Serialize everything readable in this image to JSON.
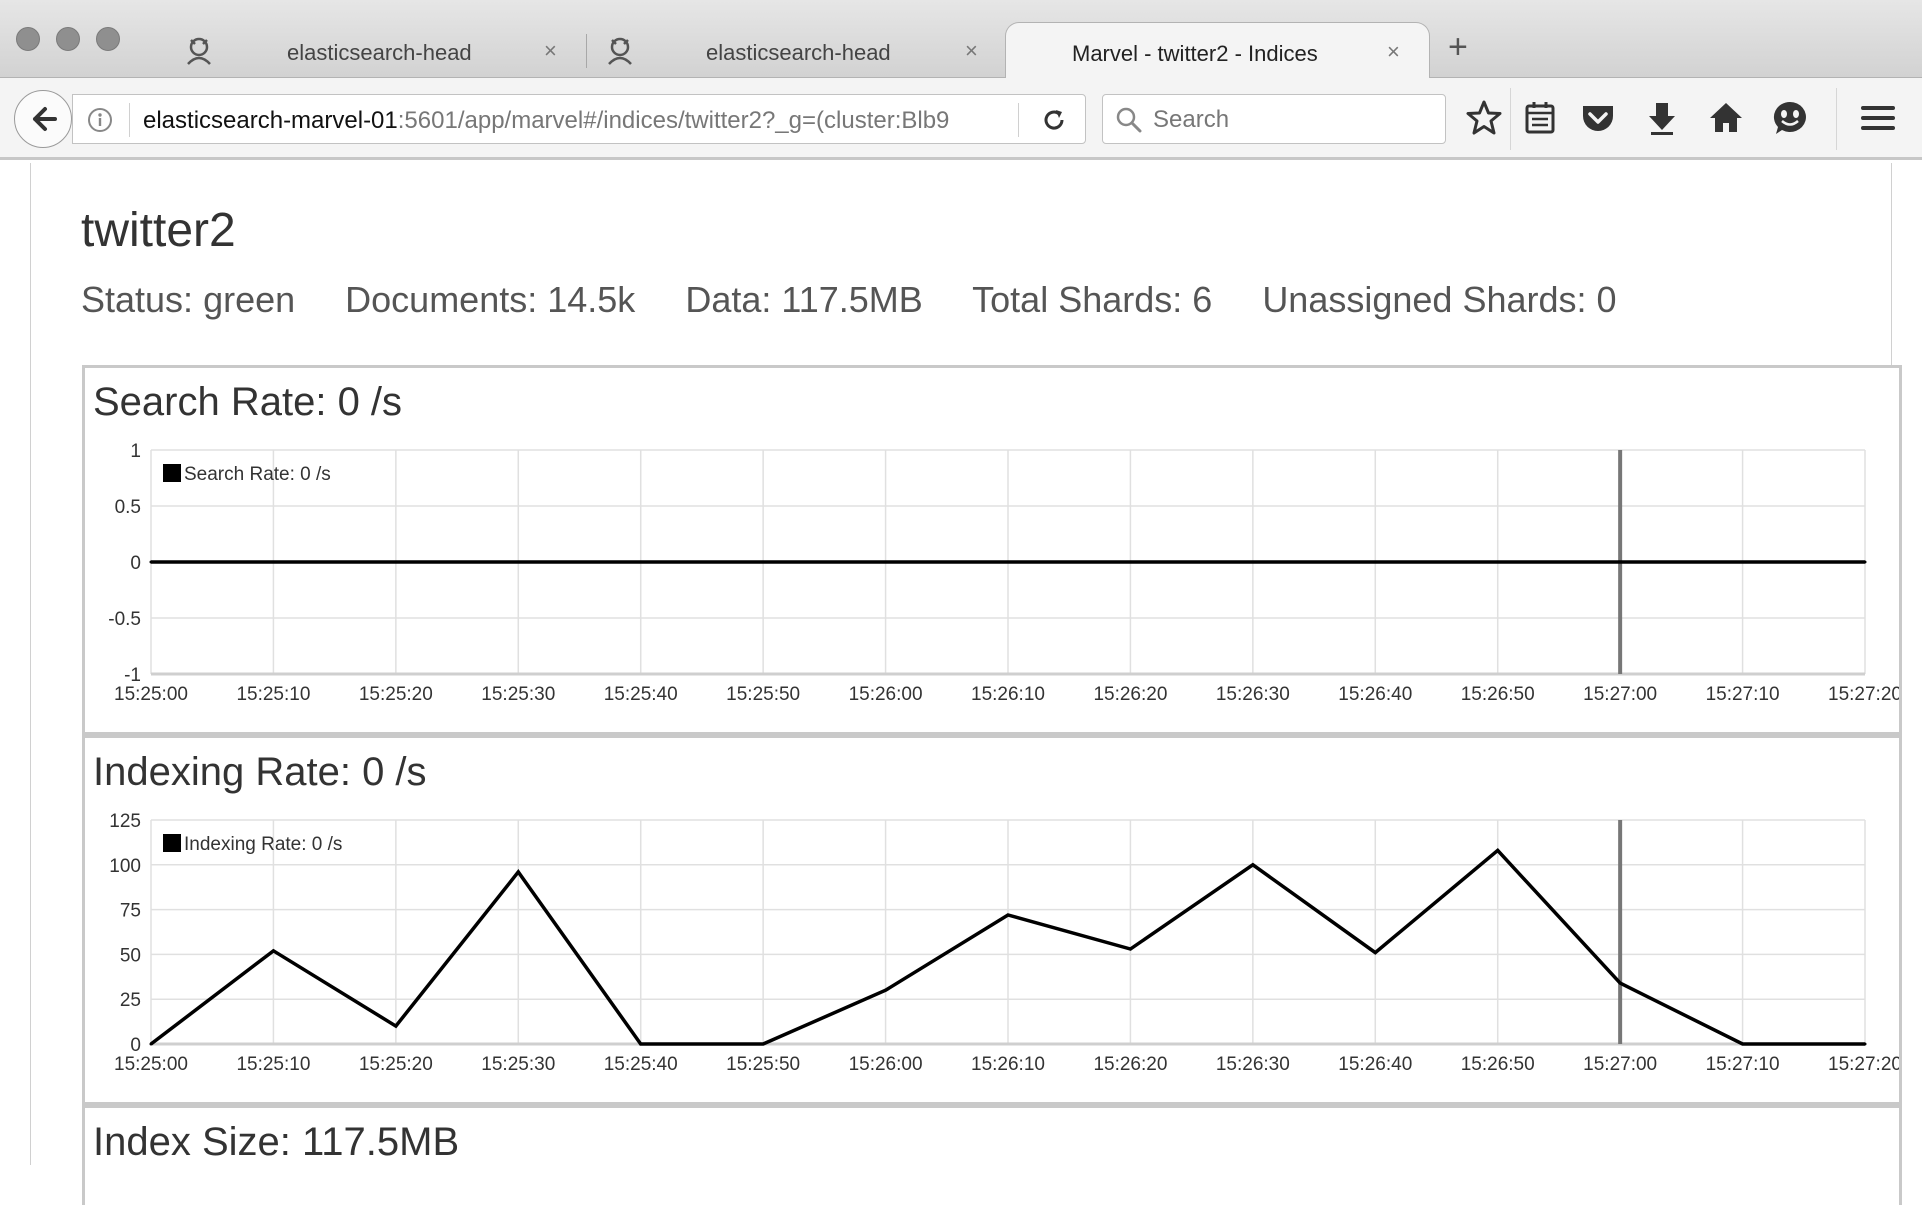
{
  "browser": {
    "tabs": [
      {
        "label": "elasticsearch-head",
        "active": false,
        "icon": "elasticsearch-head-tab-icon"
      },
      {
        "label": "elasticsearch-head",
        "active": false,
        "icon": "elasticsearch-head-tab-icon"
      },
      {
        "label": "Marvel - twitter2 - Indices",
        "active": true
      }
    ],
    "close_glyph": "×",
    "new_tab_glyph": "+",
    "url_host": "elasticsearch-marvel-01",
    "url_path": ":5601/app/marvel#/indices/twitter2?_g=(cluster:Blb9",
    "search_placeholder": "Search",
    "toolbar_icons": [
      "star-icon",
      "reading-list-icon",
      "pocket-icon",
      "download-icon",
      "home-icon",
      "smiley-icon",
      "menu-icon"
    ]
  },
  "page": {
    "title": "twitter2",
    "stats": {
      "status": "Status: green",
      "documents": "Documents: 14.5k",
      "data": "Data: 117.5MB",
      "total_shards": "Total Shards: 6",
      "unassigned_shards": "Unassigned Shards: 0"
    },
    "panels": [
      {
        "title": "Search Rate: 0 /s"
      },
      {
        "title": "Indexing Rate: 0 /s"
      },
      {
        "title": "Index Size: 117.5MB"
      }
    ]
  },
  "chart_data": [
    {
      "type": "line",
      "title": "Search Rate: 0 /s",
      "x": [
        "15:25:00",
        "15:25:10",
        "15:25:20",
        "15:25:30",
        "15:25:40",
        "15:25:50",
        "15:26:00",
        "15:26:10",
        "15:26:20",
        "15:26:30",
        "15:26:40",
        "15:26:50",
        "15:27:00",
        "15:27:10",
        "15:27:20"
      ],
      "series": [
        {
          "name": "Search Rate: 0 /s",
          "values": [
            0,
            0,
            0,
            0,
            0,
            0,
            0,
            0,
            0,
            0,
            0,
            0,
            0,
            0,
            0
          ],
          "color": "#000000"
        }
      ],
      "y_ticks": [
        1,
        0.5,
        0,
        -0.5,
        -1
      ],
      "ylim": [
        -1,
        1
      ],
      "marker_x": "15:27:00",
      "grid": true,
      "legend_position": "top-left"
    },
    {
      "type": "line",
      "title": "Indexing Rate: 0 /s",
      "x": [
        "15:25:00",
        "15:25:10",
        "15:25:20",
        "15:25:30",
        "15:25:40",
        "15:25:50",
        "15:26:00",
        "15:26:10",
        "15:26:20",
        "15:26:30",
        "15:26:40",
        "15:26:50",
        "15:27:00",
        "15:27:10",
        "15:27:20"
      ],
      "series": [
        {
          "name": "Indexing Rate: 0 /s",
          "values": [
            0,
            52,
            10,
            96,
            0,
            0,
            30,
            72,
            53,
            100,
            51,
            108,
            34,
            0,
            0
          ],
          "color": "#000000"
        }
      ],
      "y_ticks": [
        125,
        100,
        75,
        50,
        25,
        0
      ],
      "ylim": [
        0,
        125
      ],
      "marker_x": "15:27:00",
      "grid": true,
      "legend_position": "top-left"
    }
  ]
}
